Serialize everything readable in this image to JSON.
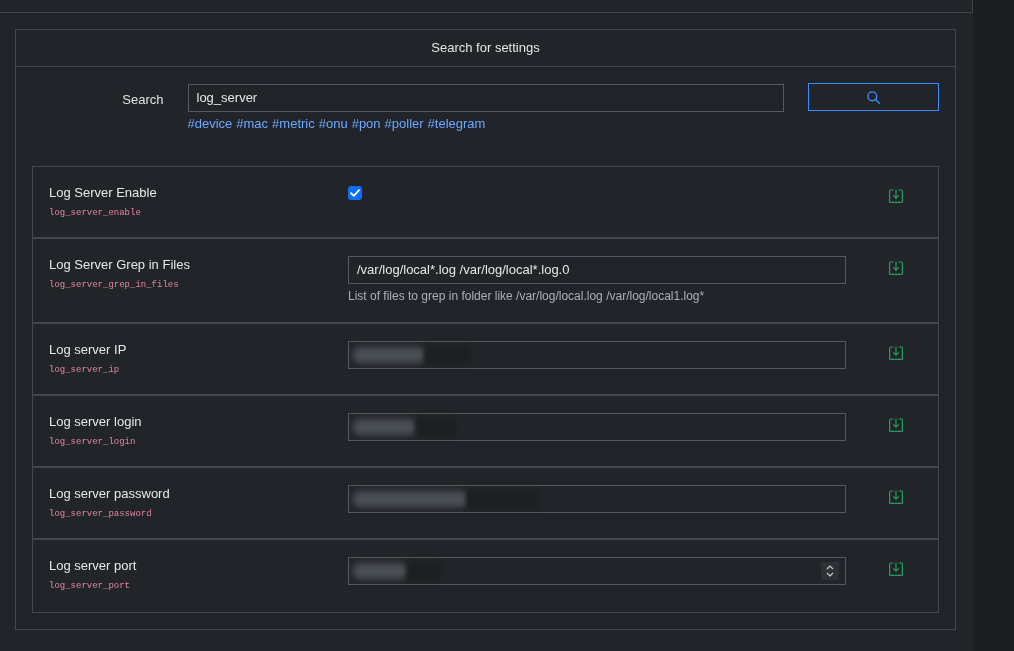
{
  "panel": {
    "title": "Search for settings"
  },
  "search": {
    "label": "Search",
    "value": "log_server",
    "tags": [
      "#device",
      "#mac",
      "#metric",
      "#onu",
      "#pon",
      "#poller",
      "#telegram"
    ]
  },
  "settings": [
    {
      "kind": "checkbox",
      "title": "Log Server Enable",
      "key": "log_server_enable",
      "checked": true
    },
    {
      "kind": "text",
      "title": "Log Server Grep in Files",
      "key": "log_server_grep_in_files",
      "value": "/var/log/local*.log /var/log/local*.log.0",
      "hint": "List of files to grep in folder like /var/log/local.log /var/log/local1.log*"
    },
    {
      "kind": "text",
      "title": "Log server IP",
      "key": "log_server_ip",
      "redacted": true
    },
    {
      "kind": "text",
      "title": "Log server login",
      "key": "log_server_login",
      "redacted": true
    },
    {
      "kind": "text",
      "title": "Log server password",
      "key": "log_server_password",
      "redacted": true
    },
    {
      "kind": "number",
      "title": "Log server port",
      "key": "log_server_port",
      "redacted": true
    }
  ]
}
